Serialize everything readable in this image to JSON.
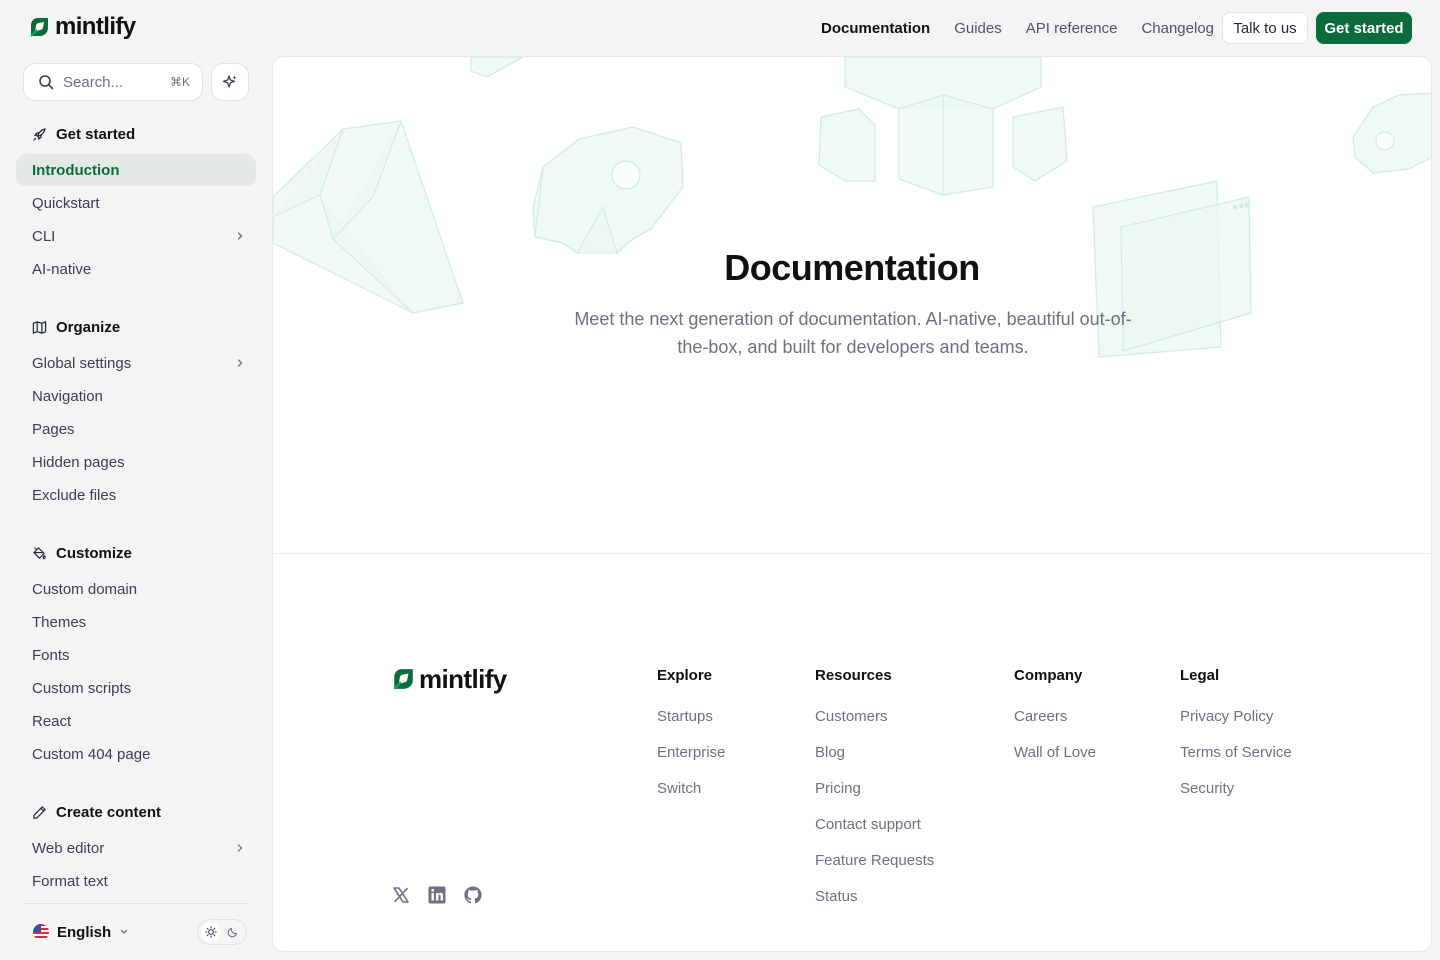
{
  "brand": {
    "name": "mintlify",
    "accent": "#0c6b3c",
    "accent_light": "#18a564"
  },
  "topnav": {
    "links": [
      "Documentation",
      "Guides",
      "API reference",
      "Changelog"
    ],
    "talk_label": "Talk to us",
    "start_label": "Get started"
  },
  "search": {
    "placeholder": "Search...",
    "shortcut": "⌘K"
  },
  "sidebar": {
    "groups": [
      {
        "title": "Get started",
        "icon": "rocket-icon",
        "items": [
          "Introduction",
          "Quickstart",
          "CLI",
          "AI-native"
        ]
      },
      {
        "title": "Organize",
        "icon": "map-icon",
        "items": [
          "Global settings",
          "Navigation",
          "Pages",
          "Hidden pages",
          "Exclude files"
        ]
      },
      {
        "title": "Customize",
        "icon": "paint-bucket-icon",
        "items": [
          "Custom domain",
          "Themes",
          "Fonts",
          "Custom scripts",
          "React",
          "Custom 404 page"
        ]
      },
      {
        "title": "Create content",
        "icon": "pencil-icon",
        "items": [
          "Web editor",
          "Format text"
        ]
      }
    ],
    "active_item": "Introduction",
    "language": "English"
  },
  "hero": {
    "title": "Documentation",
    "subtitle": "Meet the next generation of documentation. AI-native, beautiful out-of-the-box, and built for developers and teams."
  },
  "footer": {
    "columns": [
      {
        "title": "Explore",
        "links": [
          "Startups",
          "Enterprise",
          "Switch"
        ]
      },
      {
        "title": "Resources",
        "links": [
          "Customers",
          "Blog",
          "Pricing",
          "Contact support",
          "Feature Requests",
          "Status"
        ]
      },
      {
        "title": "Company",
        "links": [
          "Careers",
          "Wall of Love"
        ]
      },
      {
        "title": "Legal",
        "links": [
          "Privacy Policy",
          "Terms of Service",
          "Security"
        ]
      }
    ],
    "social": [
      "x-icon",
      "linkedin-icon",
      "github-icon"
    ]
  }
}
